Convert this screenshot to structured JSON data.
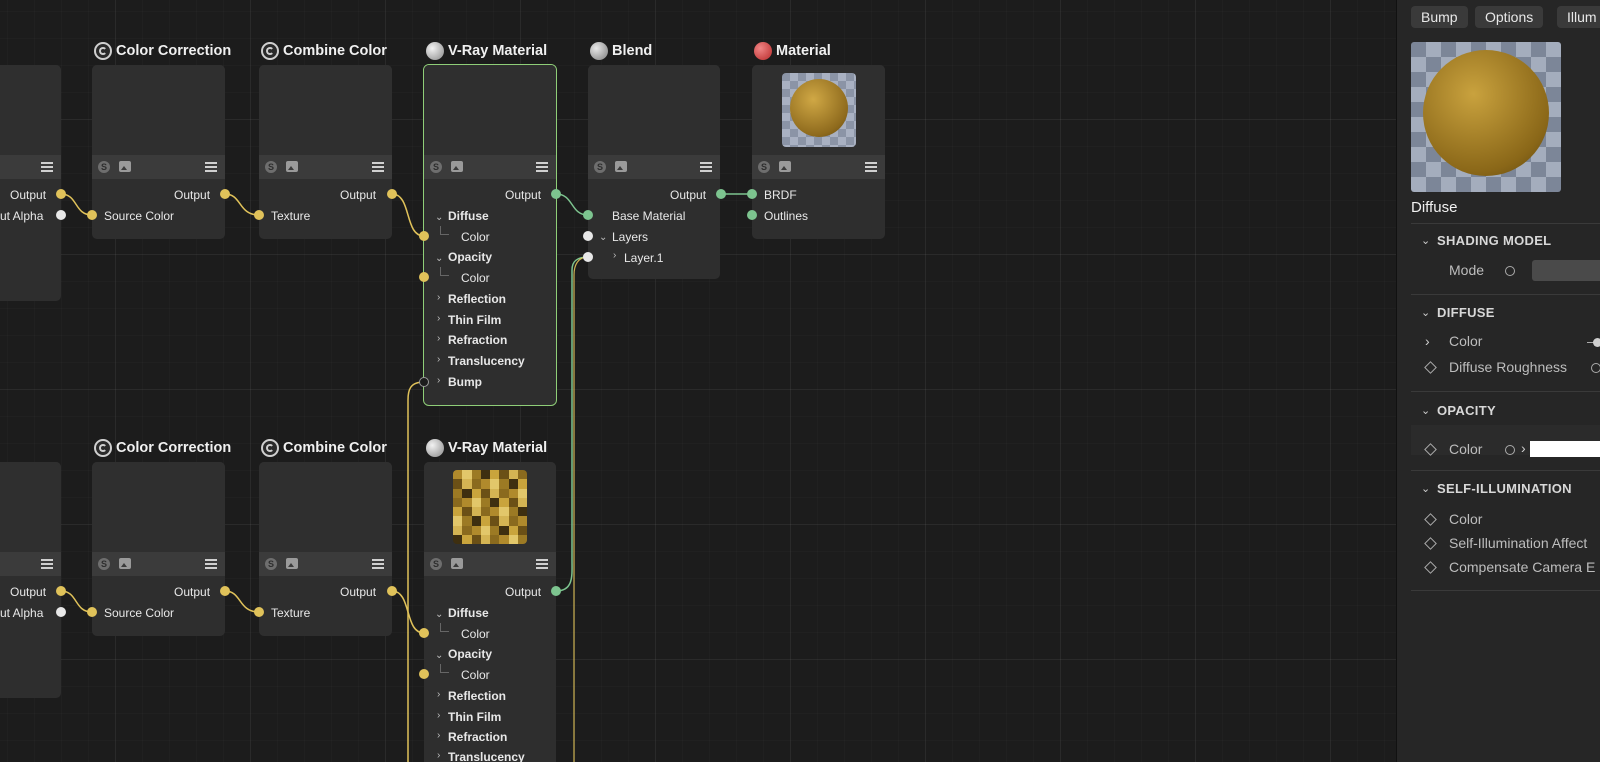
{
  "node_title_color_correction": "Color Correction",
  "node_title_combine_color": "Combine Color",
  "node_title_vray_material": "V-Ray Material",
  "node_title_blend": "Blend",
  "node_title_material": "Material",
  "ports": {
    "output": "Output",
    "out_alpha": "ut Alpha",
    "source_color": "Source Color",
    "texture": "Texture",
    "diffuse": "Diffuse",
    "color": "Color",
    "opacity": "Opacity",
    "reflection": "Reflection",
    "thin_film": "Thin Film",
    "refraction": "Refraction",
    "translucency": "Translucency",
    "bump": "Bump",
    "base_material": "Base Material",
    "layers": "Layers",
    "layer1": "Layer.1",
    "brdf": "BRDF",
    "outlines": "Outlines"
  },
  "panel": {
    "tabs": [
      "Bump",
      "Options",
      "Illum"
    ],
    "preview_title": "Diffuse",
    "sections": {
      "shading_model": "SHADING MODEL",
      "diffuse": "DIFFUSE",
      "opacity": "OPACITY",
      "self_illumination": "SELF-ILLUMINATION"
    },
    "rows": {
      "mode": "Mode",
      "color": "Color",
      "diffuse_roughness": "Diffuse Roughness",
      "opacity_color": "Color",
      "si_color": "Color",
      "si_affect": "Self-Illumination Affect",
      "compensate": "Compensate Camera E"
    }
  },
  "colors": {
    "port_yellow": "#e0c25a",
    "port_green": "#7dc48f",
    "selection_outline": "#8fce78",
    "material_icon": "#c94545"
  },
  "icons": [
    "color-correction-icon",
    "combine-color-icon",
    "vray-material-icon",
    "blend-icon",
    "material-icon",
    "menu-icon",
    "image-icon",
    "shader-icon"
  ]
}
